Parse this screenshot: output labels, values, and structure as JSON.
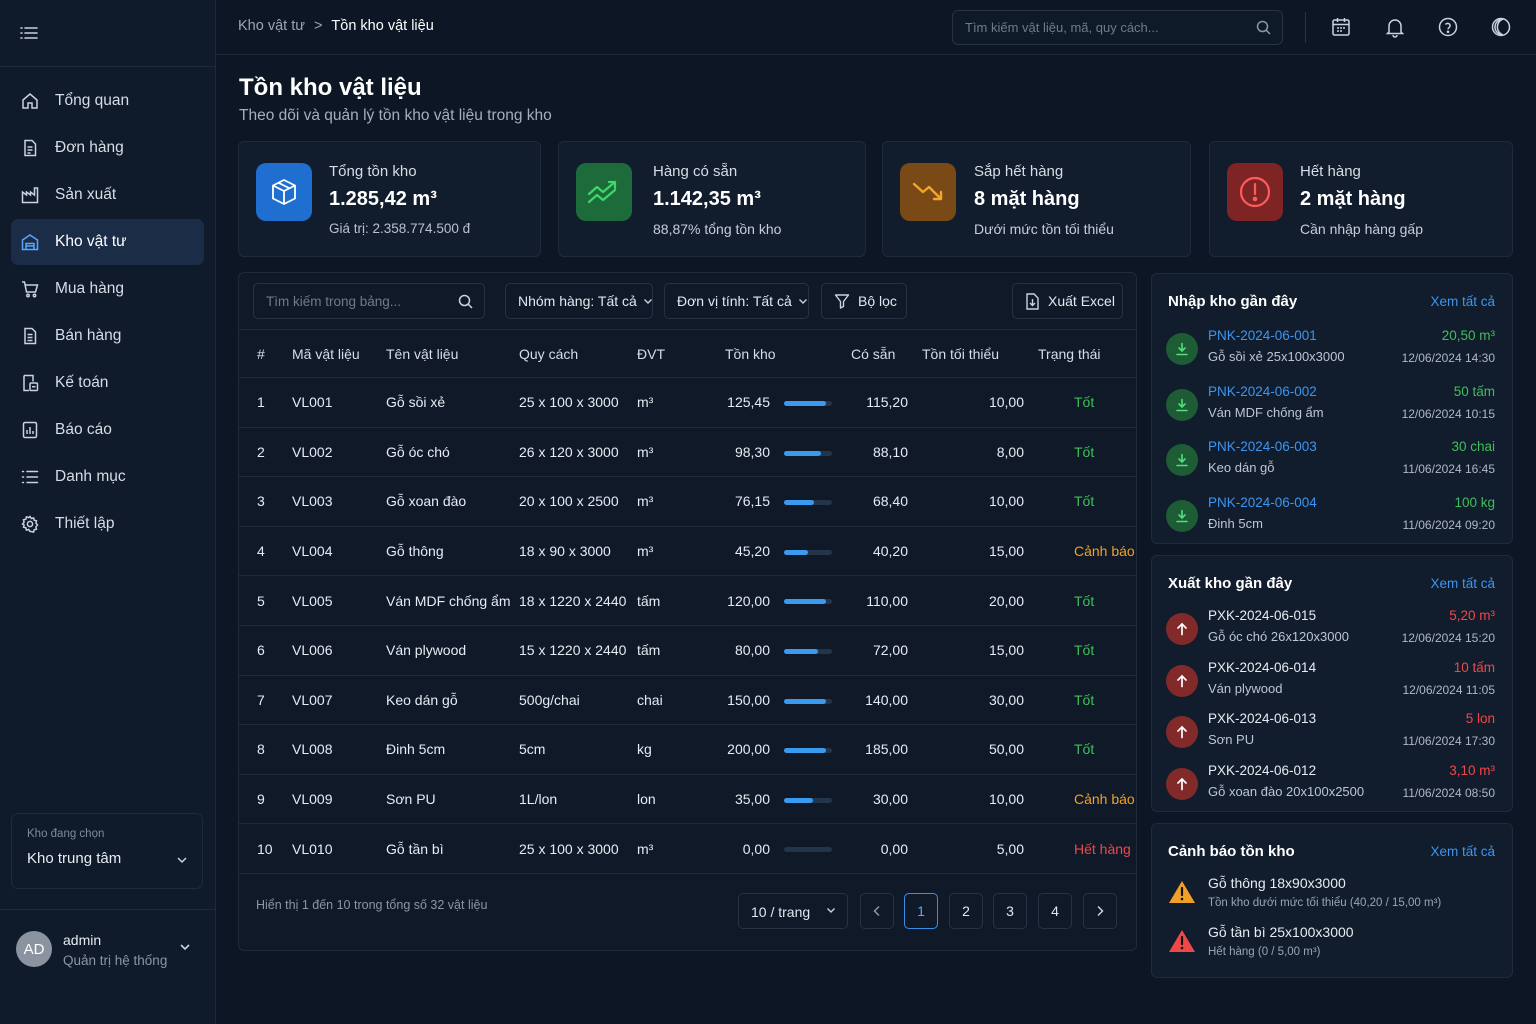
{
  "breadcrumb": {
    "parent": "Kho vật tư",
    "sep": ">",
    "current": "Tồn kho vật liệu"
  },
  "search": {
    "placeholder": "Tìm kiếm vật liệu, mã, quy cách..."
  },
  "sidebar": {
    "items": [
      {
        "label": "Tổng quan",
        "icon": "home-icon"
      },
      {
        "label": "Đơn hàng",
        "icon": "document-icon"
      },
      {
        "label": "Sản xuất",
        "icon": "factory-icon"
      },
      {
        "label": "Kho vật tư",
        "icon": "warehouse-icon",
        "active": true
      },
      {
        "label": "Mua hàng",
        "icon": "cart-icon"
      },
      {
        "label": "Bán hàng",
        "icon": "receipt-icon"
      },
      {
        "label": "Kế toán",
        "icon": "calculator-icon"
      },
      {
        "label": "Báo cáo",
        "icon": "report-icon"
      },
      {
        "label": "Danh mục",
        "icon": "list-icon"
      },
      {
        "label": "Thiết lập",
        "icon": "gear-icon"
      }
    ],
    "store_label": "Kho đang chọn",
    "store_value": "Kho trung tâm"
  },
  "user": {
    "initials": "AD",
    "name": "admin",
    "role": "Quản trị hệ thống"
  },
  "page": {
    "title": "Tồn kho vật liệu",
    "subtitle": "Theo dõi và quản lý tồn kho vật liệu trong kho"
  },
  "kpis": [
    {
      "label": "Tổng tồn kho",
      "value": "1.285,42 m³",
      "note": "Giá trị: 2.358.774.500 đ",
      "color": "#1f6fd0"
    },
    {
      "label": "Hàng có sẵn",
      "value": "1.142,35 m³",
      "note": "88,87% tổng tồn kho",
      "color": "#1d6b3a"
    },
    {
      "label": "Sắp hết hàng",
      "value": "8 mặt hàng",
      "note": "Dưới mức tồn tối thiểu",
      "color": "#7a4a16"
    },
    {
      "label": "Hết hàng",
      "value": "2 mặt hàng",
      "note": "Cần nhập hàng gấp",
      "color": "#7f2424"
    }
  ],
  "table": {
    "search_placeholder": "Tìm kiếm trong bảng...",
    "filter_group": "Nhóm hàng: Tất cả",
    "filter_unit": "Đơn vị tính: Tất cả",
    "filter_btn": "Bộ lọc",
    "export_btn": "Xuất Excel",
    "headers": [
      "#",
      "Mã vật liệu",
      "Tên vật liệu",
      "Quy cách",
      "ĐVT",
      "Tồn kho",
      "Có sẵn",
      "Tồn tối thiểu",
      "Trạng thái"
    ],
    "rows": [
      {
        "idx": "1",
        "code": "VL001",
        "name": "Gỗ sồi xẻ",
        "spec": "25 x 100 x 3000",
        "unit": "m³",
        "stock": "125,45",
        "level": 0.88,
        "avail": "115,20",
        "min": "10,00",
        "status": "Tốt",
        "kind": "good"
      },
      {
        "idx": "2",
        "code": "VL002",
        "name": "Gỗ óc chó",
        "spec": "26 x 120 x 3000",
        "unit": "m³",
        "stock": "98,30",
        "level": 0.78,
        "avail": "88,10",
        "min": "8,00",
        "status": "Tốt",
        "kind": "good"
      },
      {
        "idx": "3",
        "code": "VL003",
        "name": "Gỗ xoan đào",
        "spec": "20 x 100 x 2500",
        "unit": "m³",
        "stock": "76,15",
        "level": 0.62,
        "avail": "68,40",
        "min": "10,00",
        "status": "Tốt",
        "kind": "good"
      },
      {
        "idx": "4",
        "code": "VL004",
        "name": "Gỗ thông",
        "spec": "18 x 90 x 3000",
        "unit": "m³",
        "stock": "45,20",
        "level": 0.5,
        "avail": "40,20",
        "min": "15,00",
        "status": "Cảnh báo",
        "kind": "warn"
      },
      {
        "idx": "5",
        "code": "VL005",
        "name": "Ván MDF chống ẩm",
        "spec": "18 x 1220 x 2440",
        "unit": "tấm",
        "stock": "120,00",
        "level": 0.88,
        "avail": "110,00",
        "min": "20,00",
        "status": "Tốt",
        "kind": "good"
      },
      {
        "idx": "6",
        "code": "VL006",
        "name": "Ván plywood",
        "spec": "15 x 1220 x 2440",
        "unit": "tấm",
        "stock": "80,00",
        "level": 0.7,
        "avail": "72,00",
        "min": "15,00",
        "status": "Tốt",
        "kind": "good"
      },
      {
        "idx": "7",
        "code": "VL007",
        "name": "Keo dán gỗ",
        "spec": "500g/chai",
        "unit": "chai",
        "stock": "150,00",
        "level": 0.88,
        "avail": "140,00",
        "min": "30,00",
        "status": "Tốt",
        "kind": "good"
      },
      {
        "idx": "8",
        "code": "VL008",
        "name": "Đinh 5cm",
        "spec": "5cm",
        "unit": "kg",
        "stock": "200,00",
        "level": 0.88,
        "avail": "185,00",
        "min": "50,00",
        "status": "Tốt",
        "kind": "good"
      },
      {
        "idx": "9",
        "code": "VL009",
        "name": "Sơn PU",
        "spec": "1L/lon",
        "unit": "lon",
        "stock": "35,00",
        "level": 0.6,
        "avail": "30,00",
        "min": "10,00",
        "status": "Cảnh báo",
        "kind": "warn"
      },
      {
        "idx": "10",
        "code": "VL010",
        "name": "Gỗ tần bì",
        "spec": "25 x 100 x 3000",
        "unit": "m³",
        "stock": "0,00",
        "level": 0,
        "avail": "0,00",
        "min": "5,00",
        "status": "Hết hàng",
        "kind": "out"
      }
    ],
    "footer_info": "Hiển thị 1 đến 10 trong tổng số 32 vật liệu",
    "page_size": "10 / trang",
    "pages": [
      "1",
      "2",
      "3",
      "4"
    ]
  },
  "imports": {
    "title": "Nhập kho gần đây",
    "link": "Xem tất cả",
    "items": [
      {
        "code": "PNK-2024-06-001",
        "name": "Gỗ sồi xẻ 25x100x3000",
        "qty": "20,50 m³",
        "time": "12/06/2024 14:30"
      },
      {
        "code": "PNK-2024-06-002",
        "name": "Ván MDF chống ẩm",
        "qty": "50 tấm",
        "time": "12/06/2024 10:15"
      },
      {
        "code": "PNK-2024-06-003",
        "name": "Keo dán gỗ",
        "qty": "30 chai",
        "time": "11/06/2024 16:45"
      },
      {
        "code": "PNK-2024-06-004",
        "name": "Đinh 5cm",
        "qty": "100 kg",
        "time": "11/06/2024 09:20"
      }
    ]
  },
  "exports": {
    "title": "Xuất kho gần đây",
    "link": "Xem tất cả",
    "items": [
      {
        "code": "PXK-2024-06-015",
        "name": "Gỗ óc chó 26x120x3000",
        "qty": "5,20 m³",
        "time": "12/06/2024 15:20"
      },
      {
        "code": "PXK-2024-06-014",
        "name": "Ván plywood",
        "qty": "10 tấm",
        "time": "12/06/2024 11:05"
      },
      {
        "code": "PXK-2024-06-013",
        "name": "Sơn PU",
        "qty": "5 lon",
        "time": "11/06/2024 17:30"
      },
      {
        "code": "PXK-2024-06-012",
        "name": "Gỗ xoan đào 20x100x2500",
        "qty": "3,10 m³",
        "time": "11/06/2024 08:50"
      }
    ]
  },
  "alerts": {
    "title": "Cảnh báo tồn kho",
    "link": "Xem tất cả",
    "items": [
      {
        "title": "Gỗ thông 18x90x3000",
        "note": "Tồn kho dưới mức tối thiểu (40,20 / 15,00 m³)",
        "kind": "warn"
      },
      {
        "title": "Gỗ tần bì 25x100x3000",
        "note": "Hết hàng (0 / 5,00 m³)",
        "kind": "out"
      }
    ]
  },
  "colors": {
    "accent": "#3a9af0",
    "good": "#3fbf5a",
    "warn": "#f0a029",
    "out": "#f04848",
    "link": "#3d95f0"
  }
}
